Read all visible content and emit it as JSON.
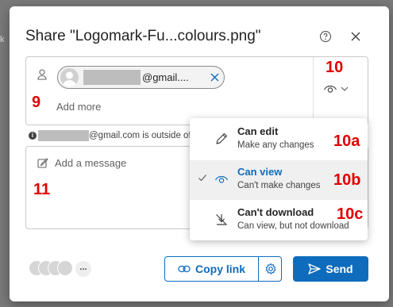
{
  "background": {
    "peek_text": "k"
  },
  "dialog": {
    "title": "Share \"Logomark-Fu...colours.png\"",
    "help_icon": "help-circle-icon",
    "close_icon": "close-icon"
  },
  "recipients": {
    "chip_email_suffix": "@gmail....",
    "add_more_placeholder": "Add more"
  },
  "info": {
    "text": "@gmail.com is outside of"
  },
  "message": {
    "placeholder": "Add a message"
  },
  "annotations": {
    "a9": "9",
    "a10": "10",
    "a10a": "10a",
    "a10b": "10b",
    "a10c": "10c",
    "a11": "11"
  },
  "permission_menu": {
    "items": [
      {
        "title": "Can edit",
        "subtitle": "Make any changes",
        "icon": "pencil-icon",
        "selected": false
      },
      {
        "title": "Can view",
        "subtitle": "Can't make changes",
        "icon": "eye-icon",
        "selected": true
      },
      {
        "title": "Can't download",
        "subtitle": "Can view, but not download",
        "icon": "no-download-icon",
        "selected": false
      }
    ]
  },
  "footer": {
    "more_avatars": "...",
    "copy_link_label": "Copy link",
    "send_label": "Send"
  },
  "colors": {
    "accent": "#0f6cbd",
    "annotation": "#e00000"
  }
}
